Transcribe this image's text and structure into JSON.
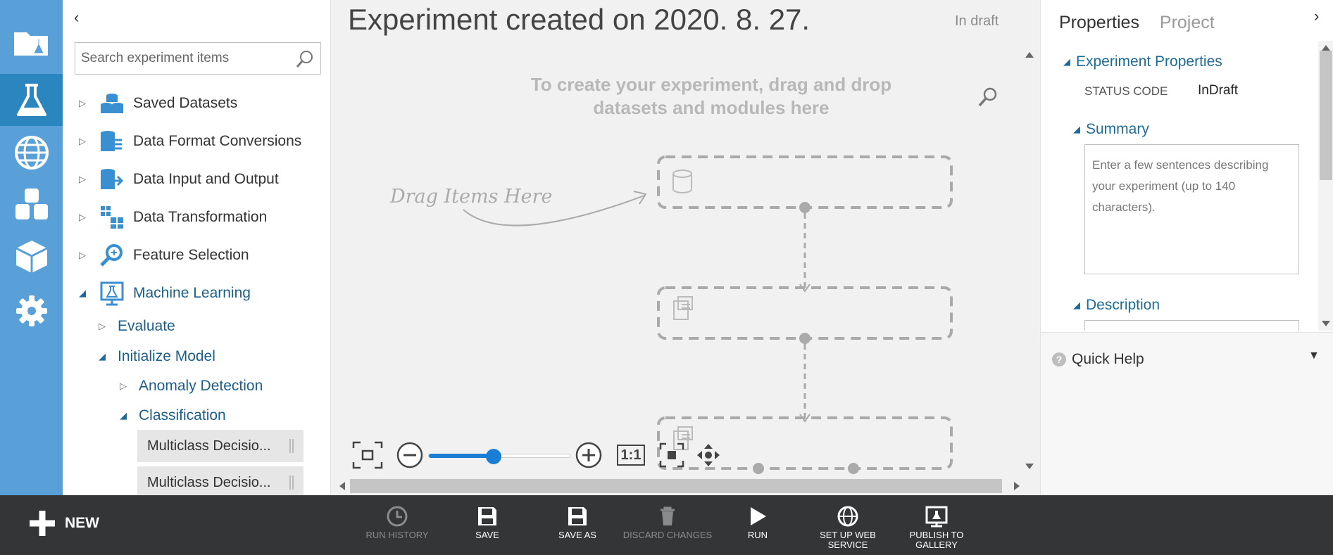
{
  "palette": {
    "collapse_glyph": "‹",
    "search_placeholder": "Search experiment items",
    "tree": [
      {
        "label": "Saved Datasets",
        "icon": "dataset-stack-icon"
      },
      {
        "label": "Data Format Conversions",
        "icon": "data-format-conversion-icon"
      },
      {
        "label": "Data Input and Output",
        "icon": "data-input-output-icon"
      },
      {
        "label": "Data Transformation",
        "icon": "data-transformation-icon"
      },
      {
        "label": "Feature Selection",
        "icon": "feature-selection-icon"
      },
      {
        "label": "Machine Learning",
        "icon": "machine-learning-icon"
      }
    ],
    "ml_children": {
      "evaluate": "Evaluate",
      "initialize_model": "Initialize Model",
      "anomaly_detection": "Anomaly Detection",
      "classification": "Classification"
    },
    "modules": [
      "Multiclass Decisio...",
      "Multiclass Decisio..."
    ]
  },
  "canvas": {
    "title": "Experiment created on 2020. 8. 27.",
    "status": "In draft",
    "hint_line1": "To create your experiment, drag and drop",
    "hint_line2": "datasets and modules here",
    "drag_label": "Drag Items Here",
    "zoom": {
      "level_fraction": 0.46,
      "one_to_one_label": "1:1"
    }
  },
  "properties": {
    "tabs": [
      "Properties",
      "Project"
    ],
    "sections": {
      "experiment_properties": "Experiment Properties",
      "summary": "Summary",
      "description": "Description"
    },
    "status_code_label": "STATUS CODE",
    "status_code_value": "InDraft",
    "summary_placeholder": "Enter a few sentences describing your experiment (up to 140 characters).",
    "quick_help": "Quick Help"
  },
  "cmdbar": {
    "new_label": "NEW",
    "commands": [
      {
        "label": "RUN HISTORY",
        "icon": "history-clock-icon",
        "enabled": false
      },
      {
        "label": "SAVE",
        "icon": "save-disk-icon",
        "enabled": true
      },
      {
        "label": "SAVE AS",
        "icon": "save-as-disk-icon",
        "enabled": true
      },
      {
        "label": "DISCARD CHANGES",
        "icon": "trash-icon",
        "enabled": false
      },
      {
        "label": "RUN",
        "icon": "play-icon",
        "enabled": true
      },
      {
        "label": "SET UP WEB SERVICE",
        "icon": "web-service-icon",
        "enabled": true
      },
      {
        "label": "PUBLISH TO GALLERY",
        "icon": "gallery-icon",
        "enabled": true
      }
    ]
  },
  "colors": {
    "rail": "#5aa0d8",
    "rail_active": "#2b86c0",
    "accent": "#1a7fd4",
    "link_blue": "#1c6b99",
    "cmdbar": "#333537"
  }
}
